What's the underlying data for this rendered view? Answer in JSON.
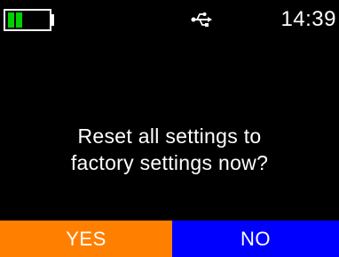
{
  "status": {
    "time": "14:39",
    "battery_icon": "battery-icon",
    "battery_bars_filled": 2,
    "usb_icon": "usb-icon",
    "battery_color": "#00d000"
  },
  "dialog": {
    "line1": "Reset all settings to",
    "line2": "factory settings now?"
  },
  "buttons": {
    "yes_label": "YES",
    "no_label": "NO",
    "yes_color": "#ff7f00",
    "no_color": "#0000ff"
  }
}
